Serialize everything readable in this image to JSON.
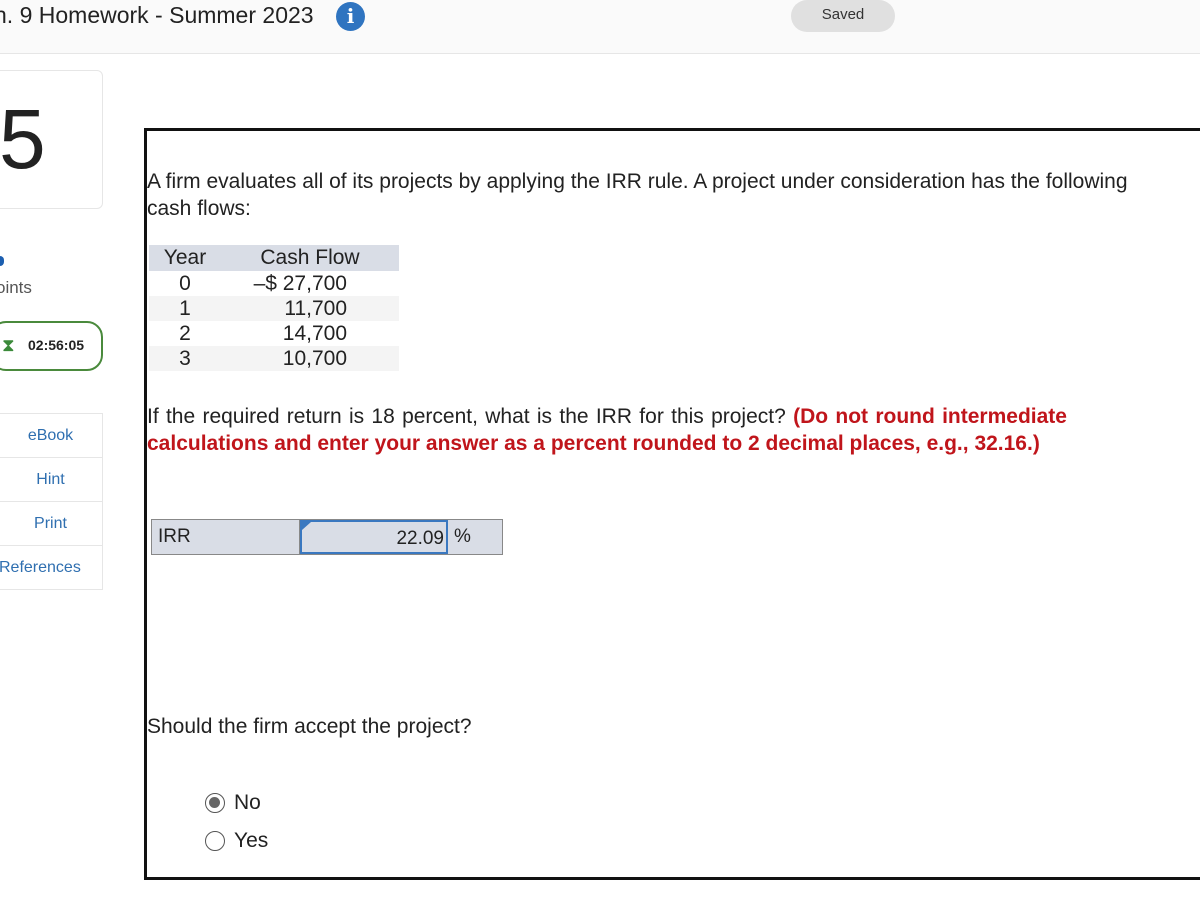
{
  "header": {
    "title": "h. 9 Homework - Summer 2023",
    "saved": "Saved"
  },
  "sidebar": {
    "question_number": "5",
    "points_label": "oints",
    "timer": "02:56:05",
    "items": [
      "eBook",
      "Hint",
      "Print",
      "References"
    ]
  },
  "question": {
    "intro": "A firm evaluates all of its projects by applying the IRR rule. A project under consideration has the following cash flows:",
    "table": {
      "headers": [
        "Year",
        "Cash Flow"
      ],
      "rows": [
        [
          "0",
          "–$ 27,700"
        ],
        [
          "1",
          "11,700"
        ],
        [
          "2",
          "14,700"
        ],
        [
          "3",
          "10,700"
        ]
      ]
    },
    "prompt": "If the required return is 18 percent, what is the IRR for this project?",
    "instruction": "(Do not round intermediate calculations and enter your answer as a percent rounded to 2 decimal places, e.g., 32.16.)",
    "answer": {
      "label": "IRR",
      "value": "22.09",
      "unit": "%"
    },
    "accept_prompt": "Should the firm accept the project?",
    "options": [
      {
        "label": "No",
        "selected": true
      },
      {
        "label": "Yes",
        "selected": false
      }
    ]
  }
}
